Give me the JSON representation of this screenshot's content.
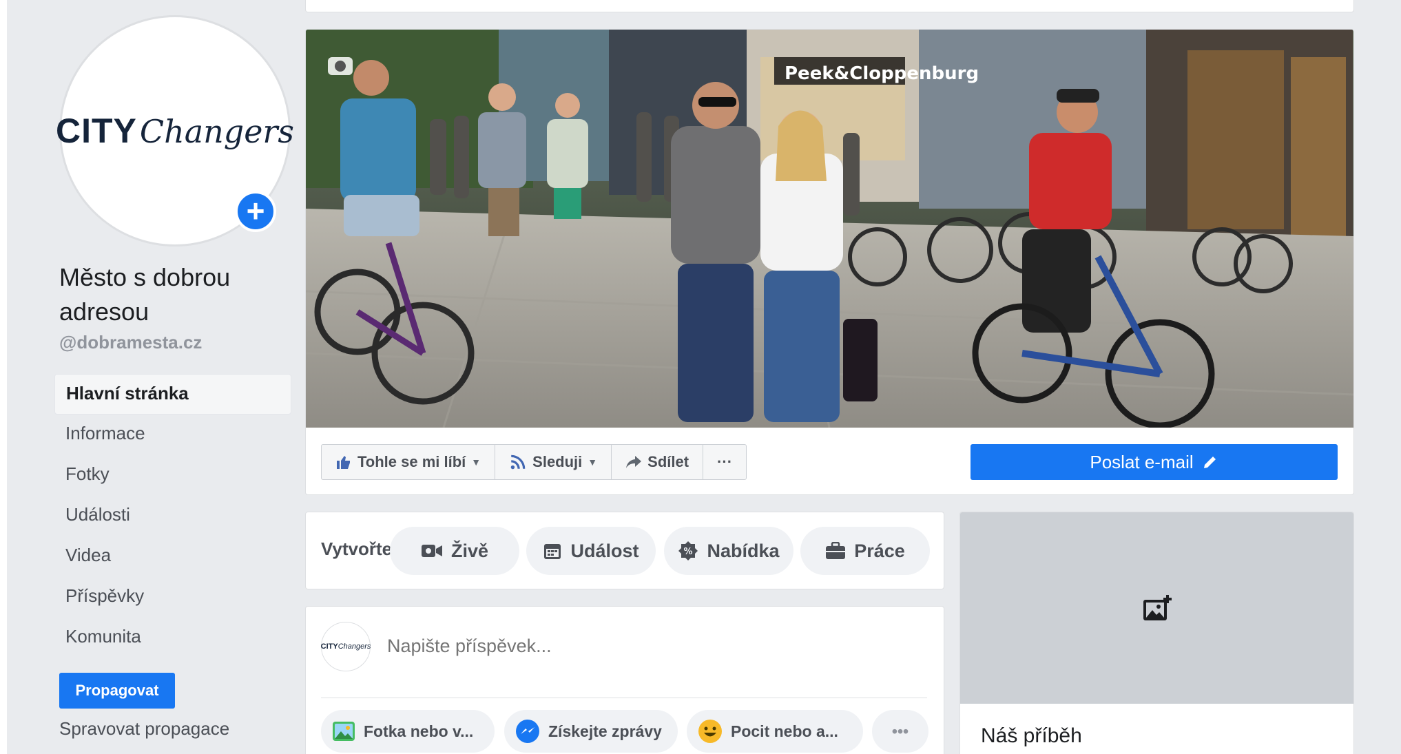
{
  "page": {
    "logo_main": "CITY",
    "logo_script": "Changers",
    "name": "Město s dobrou adresou",
    "handle": "@dobramesta.cz",
    "cover_sign": "Peek&Cloppenburg"
  },
  "sidebar": {
    "items": [
      {
        "label": "Hlavní stránka",
        "active": true
      },
      {
        "label": "Informace"
      },
      {
        "label": "Fotky"
      },
      {
        "label": "Události"
      },
      {
        "label": "Videa"
      },
      {
        "label": "Příspěvky"
      },
      {
        "label": "Komunita"
      }
    ],
    "promote_label": "Propagovat",
    "manage_label": "Spravovat propagace"
  },
  "actions": {
    "like_label": "Tohle se mi líbí",
    "follow_label": "Sleduji",
    "share_label": "Sdílet",
    "more_label": "···",
    "email_label": "Poslat e-mail"
  },
  "create": {
    "label": "Vytvořte",
    "live": "Živě",
    "event": "Událost",
    "offer": "Nabídka",
    "job": "Práce"
  },
  "post": {
    "placeholder": "Napište příspěvek...",
    "photo": "Fotka nebo v...",
    "messages": "Získejte zprávy",
    "feeling": "Pocit nebo a...",
    "more": "•••"
  },
  "story": {
    "title": "Náš příběh"
  },
  "colors": {
    "accent": "#1877f2",
    "background": "#e9ebee"
  }
}
